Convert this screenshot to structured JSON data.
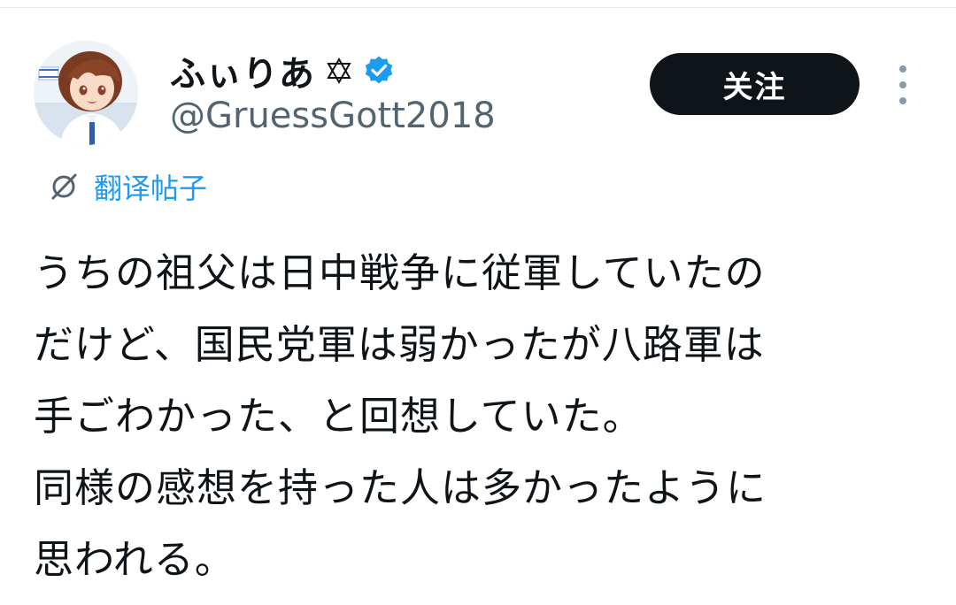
{
  "author": {
    "display_name": "ふぃりあ",
    "name_symbol": "star-of-david-icon",
    "verified": true,
    "verified_icon": "verified-badge-icon",
    "handle": "@GruessGott2018",
    "avatar": "avatar"
  },
  "actions": {
    "follow_label": "关注",
    "more_icon": "more-options-icon"
  },
  "translate": {
    "icon": "translate-icon",
    "label": "翻译帖子"
  },
  "post": {
    "lines": [
      "うちの祖父は日中戦争に従軍していたの",
      "だけど、国民党軍は弱かったが八路軍は",
      "手ごわかった、と回想していた。",
      "同様の感想を持った人は多かったように",
      "思われる。"
    ]
  },
  "colors": {
    "text_primary": "#0f1419",
    "text_secondary": "#536471",
    "link_blue": "#1d9bf0",
    "follow_bg": "#0f1419",
    "follow_text": "#ffffff",
    "verified_blue": "#1d9bf0"
  }
}
